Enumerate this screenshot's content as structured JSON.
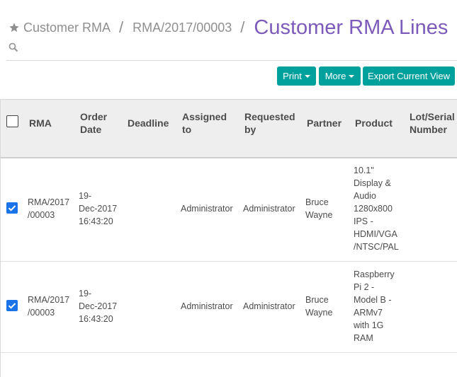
{
  "breadcrumb": {
    "star_icon": "star-icon",
    "items": [
      "Customer RMA",
      "RMA/2017/00003"
    ],
    "separator": "/",
    "current": "Customer RMA Lines"
  },
  "search": {
    "placeholder": "",
    "icon": "search-icon"
  },
  "toolbar": {
    "print_label": "Print",
    "more_label": "More",
    "export_label": "Export Current View"
  },
  "colors": {
    "accent": "#00a09d",
    "title": "#7c5bbb",
    "checkbox": "#1a73e8"
  },
  "table": {
    "headers": {
      "rma": "RMA",
      "order_date": [
        "Order",
        "Date"
      ],
      "deadline": "Deadline",
      "assigned_to": [
        "Assigned",
        "to"
      ],
      "requested_by": [
        "Requested",
        "by"
      ],
      "partner": "Partner",
      "product": "Product",
      "lot_serial": [
        "Lot/Serial",
        "Number"
      ]
    },
    "rows": [
      {
        "selected": true,
        "rma": [
          "RMA/2017",
          "/00003"
        ],
        "order_date": [
          "19-",
          "Dec-2017",
          "16:43:20"
        ],
        "deadline": "",
        "assigned_to": "Administrator",
        "requested_by": "Administrator",
        "partner": [
          "Bruce",
          "Wayne"
        ],
        "product": [
          "10.1\"",
          "Display &",
          "Audio",
          "1280x800",
          "IPS -",
          "HDMI/VGA",
          "/NTSC/PAL"
        ],
        "lot_serial": ""
      },
      {
        "selected": true,
        "rma": [
          "RMA/2017",
          "/00003"
        ],
        "order_date": [
          "19-",
          "Dec-2017",
          "16:43:20"
        ],
        "deadline": "",
        "assigned_to": "Administrator",
        "requested_by": "Administrator",
        "partner": [
          "Bruce",
          "Wayne"
        ],
        "product": [
          "Raspberry",
          "Pi 2 -",
          "Model B -",
          "ARMv7",
          "with 1G",
          "RAM"
        ],
        "lot_serial": ""
      }
    ]
  }
}
